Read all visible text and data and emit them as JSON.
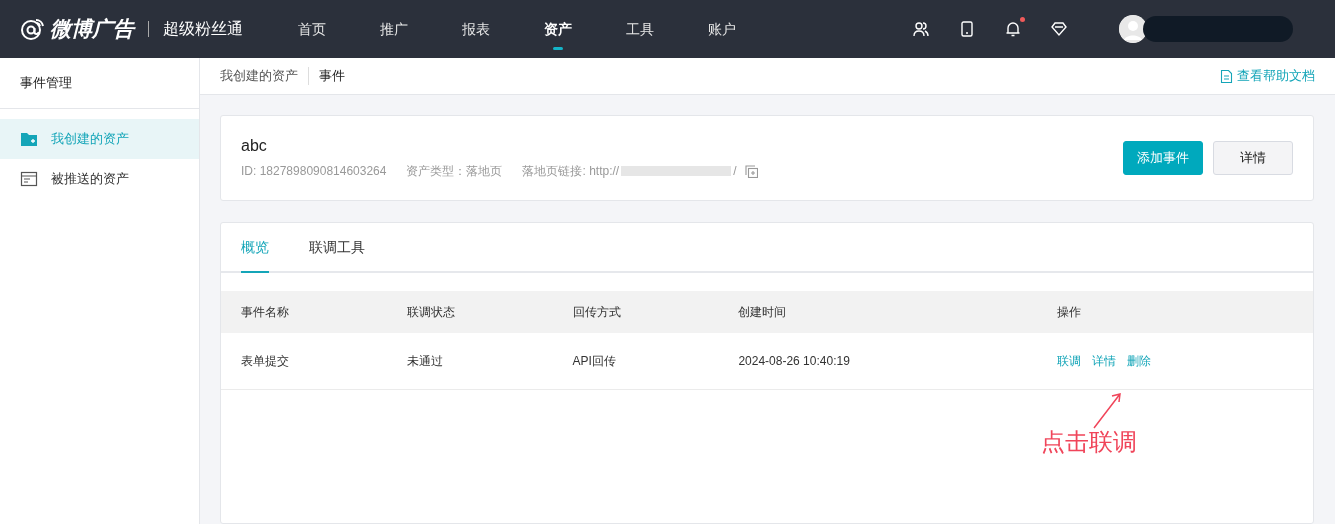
{
  "header": {
    "logo": "微博广告",
    "product": "超级粉丝通",
    "nav": [
      {
        "label": "首页",
        "selected": false
      },
      {
        "label": "推广",
        "selected": false
      },
      {
        "label": "报表",
        "selected": false
      },
      {
        "label": "资产",
        "selected": true
      },
      {
        "label": "工具",
        "selected": false
      },
      {
        "label": "账户",
        "selected": false
      }
    ],
    "notification_dot": true
  },
  "sidebar": {
    "title": "事件管理",
    "items": [
      {
        "label": "我创建的资产",
        "selected": true,
        "kind": "folder"
      },
      {
        "label": "被推送的资产",
        "selected": false,
        "kind": "list"
      }
    ]
  },
  "breadcrumb": [
    "我创建的资产",
    "事件"
  ],
  "help_link": "查看帮助文档",
  "asset": {
    "name": "abc",
    "id": "ID: 1827898090814603264",
    "type": "资产类型：落地页",
    "link_label": "落地页链接: http://",
    "link_end": "/",
    "buttons": [
      {
        "label": "添加事件",
        "kind": "primary"
      },
      {
        "label": "详情",
        "kind": "default"
      }
    ]
  },
  "tabs": [
    {
      "label": "概览",
      "selected": true
    },
    {
      "label": "联调工具",
      "selected": false
    }
  ],
  "table": {
    "columns": [
      "事件名称",
      "联调状态",
      "回传方式",
      "创建时间",
      "操作"
    ],
    "rows": [
      {
        "cells": [
          "表单提交",
          "未通过",
          "API回传",
          "2024-08-26 10:40:19"
        ],
        "actions": [
          "联调",
          "详情",
          "删除"
        ]
      }
    ]
  },
  "annotation": "点击联调"
}
